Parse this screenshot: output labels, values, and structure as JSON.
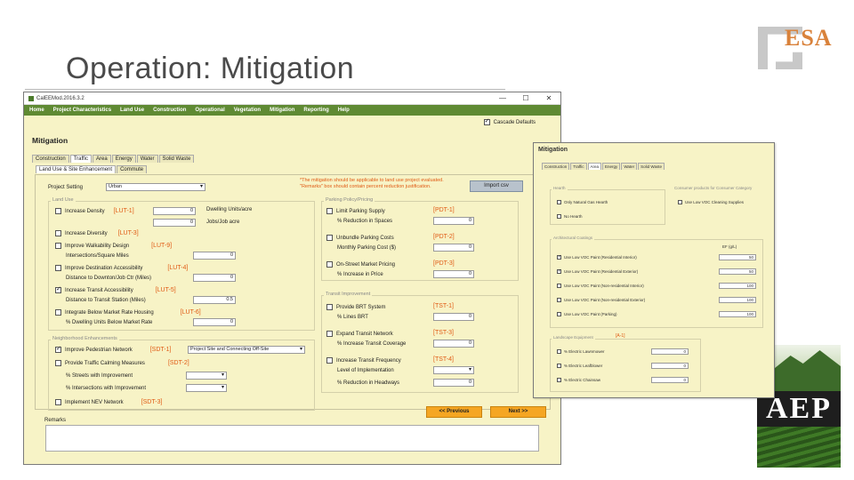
{
  "slide": {
    "title": "Operation: Mitigation"
  },
  "logos": {
    "esa": "ESA",
    "aep": "AEP"
  },
  "window": {
    "title": "CalEEMod.2016.3.2",
    "controls": [
      "—",
      "☐",
      "✕"
    ],
    "menu": [
      "Home",
      "Project Characteristics",
      "Land Use",
      "Construction",
      "Operational",
      "Vegetation",
      "Mitigation",
      "Reporting",
      "Help"
    ],
    "cascade_label": "Cascade Defaults",
    "heading": "Mitigation",
    "tabs": [
      "Construction",
      "Traffic",
      "Area",
      "Energy",
      "Water",
      "Solid Waste"
    ],
    "subtabs": [
      "Land Use & Site Enhancement",
      "Commute"
    ],
    "project_setting_label": "Project Setting",
    "project_setting_value": "Urban",
    "note": "*The mitigation should be applicable to land use project evaluated. \"Remarks\" box should contain percent reduction justification.",
    "import_label": "Import csv",
    "land_use": {
      "group": "Land Use",
      "density_label": "Increase Density",
      "density_code": "[LUT-1]",
      "dwelling_label": "Dwelling Units/acre",
      "dwelling_value": "0",
      "jobs_label": "Jobs/Job acre",
      "jobs_value": "0",
      "diversity_label": "Increase Diversity",
      "diversity_code": "[LUT-3]",
      "walk_label": "Improve Walkability Design",
      "walk_code": "[LUT-9]",
      "intersections_label": "Intersections/Square Miles",
      "intersections_value": "0",
      "dest_label": "Improve Destination Accessibility",
      "dest_code": "[LUT-4]",
      "dist_downtown_label": "Distance to Downton/Job Ctr (Miles)",
      "dist_downtown_value": "0",
      "transit_label": "Increase Transit Accessibility",
      "transit_code": "[LUT-5]",
      "dist_transit_label": "Distance to Transit Station (Miles)",
      "dist_transit_value": "0.5",
      "bmr_label": "Integrate Below Market Rate Housing",
      "bmr_code": "[LUT-6]",
      "bmr_pct_label": "% Dwelling Units Below Market Rate",
      "bmr_pct_value": "0"
    },
    "neighborhood": {
      "group": "Neighborhood Enhancements",
      "ped_label": "Improve Pedestrian Network",
      "ped_code": "[SDT-1]",
      "ped_value": "Project Site and Connecting Off-Site",
      "calm_label": "Provide Traffic Calming Measures",
      "calm_code": "[SDT-2]",
      "streets_label": "% Streets with Improvement",
      "intersect_label": "% Intersections with Improvement",
      "nev_label": "Implement NEV Network",
      "nev_code": "[SDT-3]"
    },
    "parking": {
      "group": "Parking Policy/Pricing",
      "limit_label": "Limit Parking Supply",
      "limit_code": "[PDT-1]",
      "reduction_label": "% Reduction in Spaces",
      "reduction_value": "0",
      "unbundle_label": "Unbundle Parking Costs",
      "unbundle_code": "[PDT-2]",
      "monthly_label": "Monthly Parking Cost ($)",
      "monthly_value": "0",
      "onstreet_label": "On-Street Market Pricing",
      "onstreet_code": "[PDT-3]",
      "price_label": "% Increase in Price",
      "price_value": "0"
    },
    "transit": {
      "group": "Transit Improvement",
      "brt_label": "Provide BRT System",
      "brt_code": "[TST-1]",
      "lines_label": "% Lines BRT",
      "lines_value": "0",
      "expand_label": "Expand Transit Network",
      "expand_code": "[TST-3]",
      "coverage_label": "% Increase Transit Coverage",
      "coverage_value": "0",
      "freq_label": "Increase Transit Frequency",
      "freq_code": "[TST-4]",
      "level_label": "Level of Implementation",
      "headways_label": "% Reduction in Headways",
      "headways_value": "0"
    },
    "prev_label": "<< Previous",
    "next_label": "Next >>",
    "remarks_label": "Remarks"
  },
  "window2": {
    "heading": "Mitigation",
    "tabs": [
      "Construction",
      "Traffic",
      "Area",
      "Energy",
      "Water",
      "Solid Waste"
    ],
    "hearth_group": "Hearth",
    "hearth1": "Only Natural Gas Hearth",
    "hearth2": "No Hearth",
    "consumer_group": "Consumer products for Consumer Category",
    "consumer1": "Use Low VOC Cleaning Supplies",
    "arch_group": "Architectural Coatings",
    "ef_label": "EF (g/L)",
    "coat1": "Use Low VOC Paint (Residential Interior)",
    "coat1_value": "50",
    "coat2": "Use Low VOC Paint (Residential Exterior)",
    "coat2_value": "50",
    "coat3": "Use Low VOC Paint (Non-residential Interior)",
    "coat3_value": "100",
    "coat4": "Use Low VOC Paint (Non-residential Exterior)",
    "coat4_value": "100",
    "coat5": "Use Low VOC Paint (Parking)",
    "coat5_value": "100",
    "landscape_group": "Landscape Equipment",
    "landscape_code": "[A-1]",
    "eq1": "% Electric Lawnmower",
    "eq1_value": "0",
    "eq2": "% Electric Leafblower",
    "eq2_value": "0",
    "eq3": "% Electric Chainsaw",
    "eq3_value": "0"
  }
}
